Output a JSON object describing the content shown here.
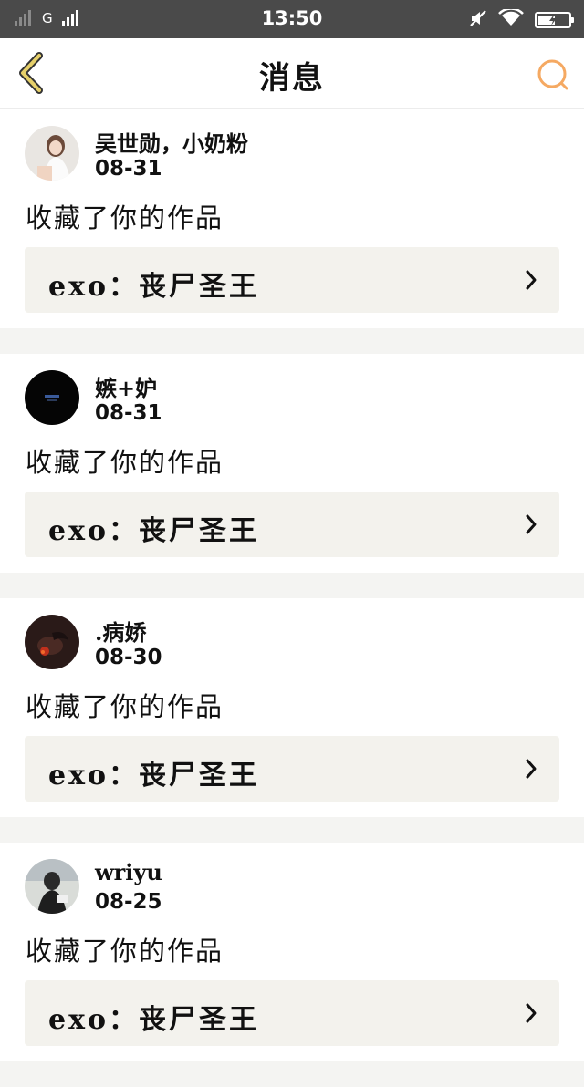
{
  "status_bar": {
    "carrier": "G",
    "time": "13:50",
    "icons": [
      "signal-bars-icon",
      "mute-icon",
      "wifi-icon",
      "battery-charging-icon"
    ]
  },
  "nav": {
    "title": "消息",
    "back_icon": "chevron-left-icon",
    "search_icon": "search-icon",
    "accent_color": "#f5a962",
    "back_color": "#e6d06a"
  },
  "messages": [
    {
      "user": "吴世勋，小奶粉",
      "date": "08-31",
      "action": "收藏了你的作品",
      "work": "exo：丧尸圣王"
    },
    {
      "user": "嫉+妒",
      "date": "08-31",
      "action": "收藏了你的作品",
      "work": "exo：丧尸圣王"
    },
    {
      "user": ".病娇",
      "date": "08-30",
      "action": "收藏了你的作品",
      "work": "exo：丧尸圣王"
    },
    {
      "user": "wriyu",
      "date": "08-25",
      "action": "收藏了你的作品",
      "work": "exo：丧尸圣王"
    }
  ]
}
